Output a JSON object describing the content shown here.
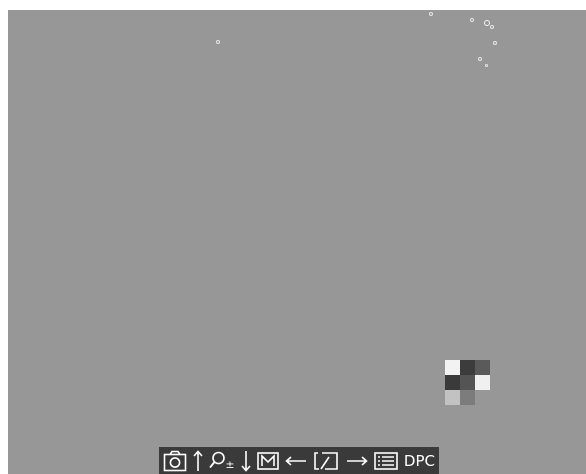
{
  "toolbar": {
    "icons": [
      "camera-icon",
      "arrow-up-icon",
      "zoom-icon",
      "arrow-down-icon",
      "mode-icon",
      "arrow-left-icon",
      "rotate-icon",
      "arrow-right-icon",
      "menu-icon"
    ],
    "zoom_suffix": "±",
    "mode_letter": "M",
    "dpc_label": "DPC"
  },
  "dpc_pattern": {
    "cells": [
      "#f2f2f2",
      "#3c3c3c",
      "#5a5a5a",
      "#3a3a3a",
      "#545454",
      "#f0f0f0",
      "#c2c2c2",
      "#7c7c7c",
      "#979797"
    ]
  },
  "colors": {
    "screen": "#979797",
    "toolbar": "#3a3a3a",
    "icon": "#ffffff"
  }
}
